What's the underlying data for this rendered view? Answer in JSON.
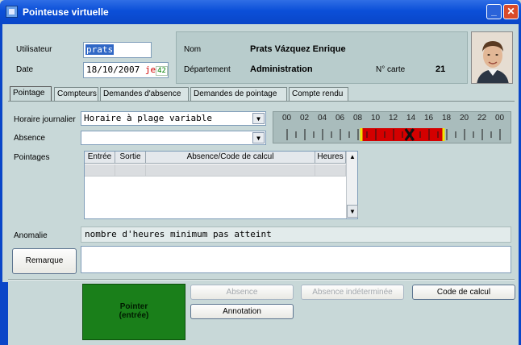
{
  "window": {
    "title": "Pointeuse virtuelle",
    "min_label": "_",
    "close_label": "✕"
  },
  "header": {
    "user_label": "Utilisateur",
    "user_value": "prats",
    "date_label": "Date",
    "date_value": "18/10/2007",
    "day_abbrev": "je",
    "week_no": "42",
    "name_label": "Nom",
    "name_value": "Prats Vázquez Enrique",
    "dept_label": "Département",
    "dept_value": "Administration",
    "card_label": "N° carte",
    "card_value": "21",
    "photo_icon": "person-photo-icon"
  },
  "tabs": [
    {
      "label": "Pointage",
      "active": true
    },
    {
      "label": "Compteurs"
    },
    {
      "label": "Demandes d'absence"
    },
    {
      "label": "Demandes de pointage"
    },
    {
      "label": "Compte rendu"
    }
  ],
  "form": {
    "schedule_label": "Horaire journalier",
    "schedule_value": "Horaire à plage variable",
    "absence_label": "Absence",
    "absence_value": "",
    "punches_label": "Pointages",
    "anomaly_label": "Anomalie",
    "anomaly_value": "nombre d'heures minimum pas atteint",
    "remark_button": "Remarque",
    "remark_value": ""
  },
  "timeline": {
    "hours": [
      "00",
      "02",
      "04",
      "06",
      "08",
      "10",
      "12",
      "14",
      "16",
      "18",
      "20",
      "22",
      "00"
    ],
    "colors": {
      "bg": "#a9bcbc",
      "active": "#d40000",
      "edge": "#f2e600",
      "tick": "#1a1a1a"
    },
    "band_start_hour": 8.5,
    "band_end_hour": 17.5,
    "mark_hour": 13.8
  },
  "grid": {
    "columns": [
      "Entrée",
      "Sortie",
      "Absence/Code de calcul",
      "Heures"
    ],
    "scroll_up": "▲",
    "scroll_down": "▼"
  },
  "actions": {
    "pointer_line1": "Pointer",
    "pointer_line2": "(entrée)",
    "absence": "Absence",
    "absence_undetermined": "Absence indéterminée",
    "calc_code": "Code de calcul",
    "annotation": "Annotation"
  },
  "colors": {
    "titlebar": "#0b4fd8",
    "window_bg": "#c8d8d8",
    "pointer_button": "#1a7f1a"
  }
}
